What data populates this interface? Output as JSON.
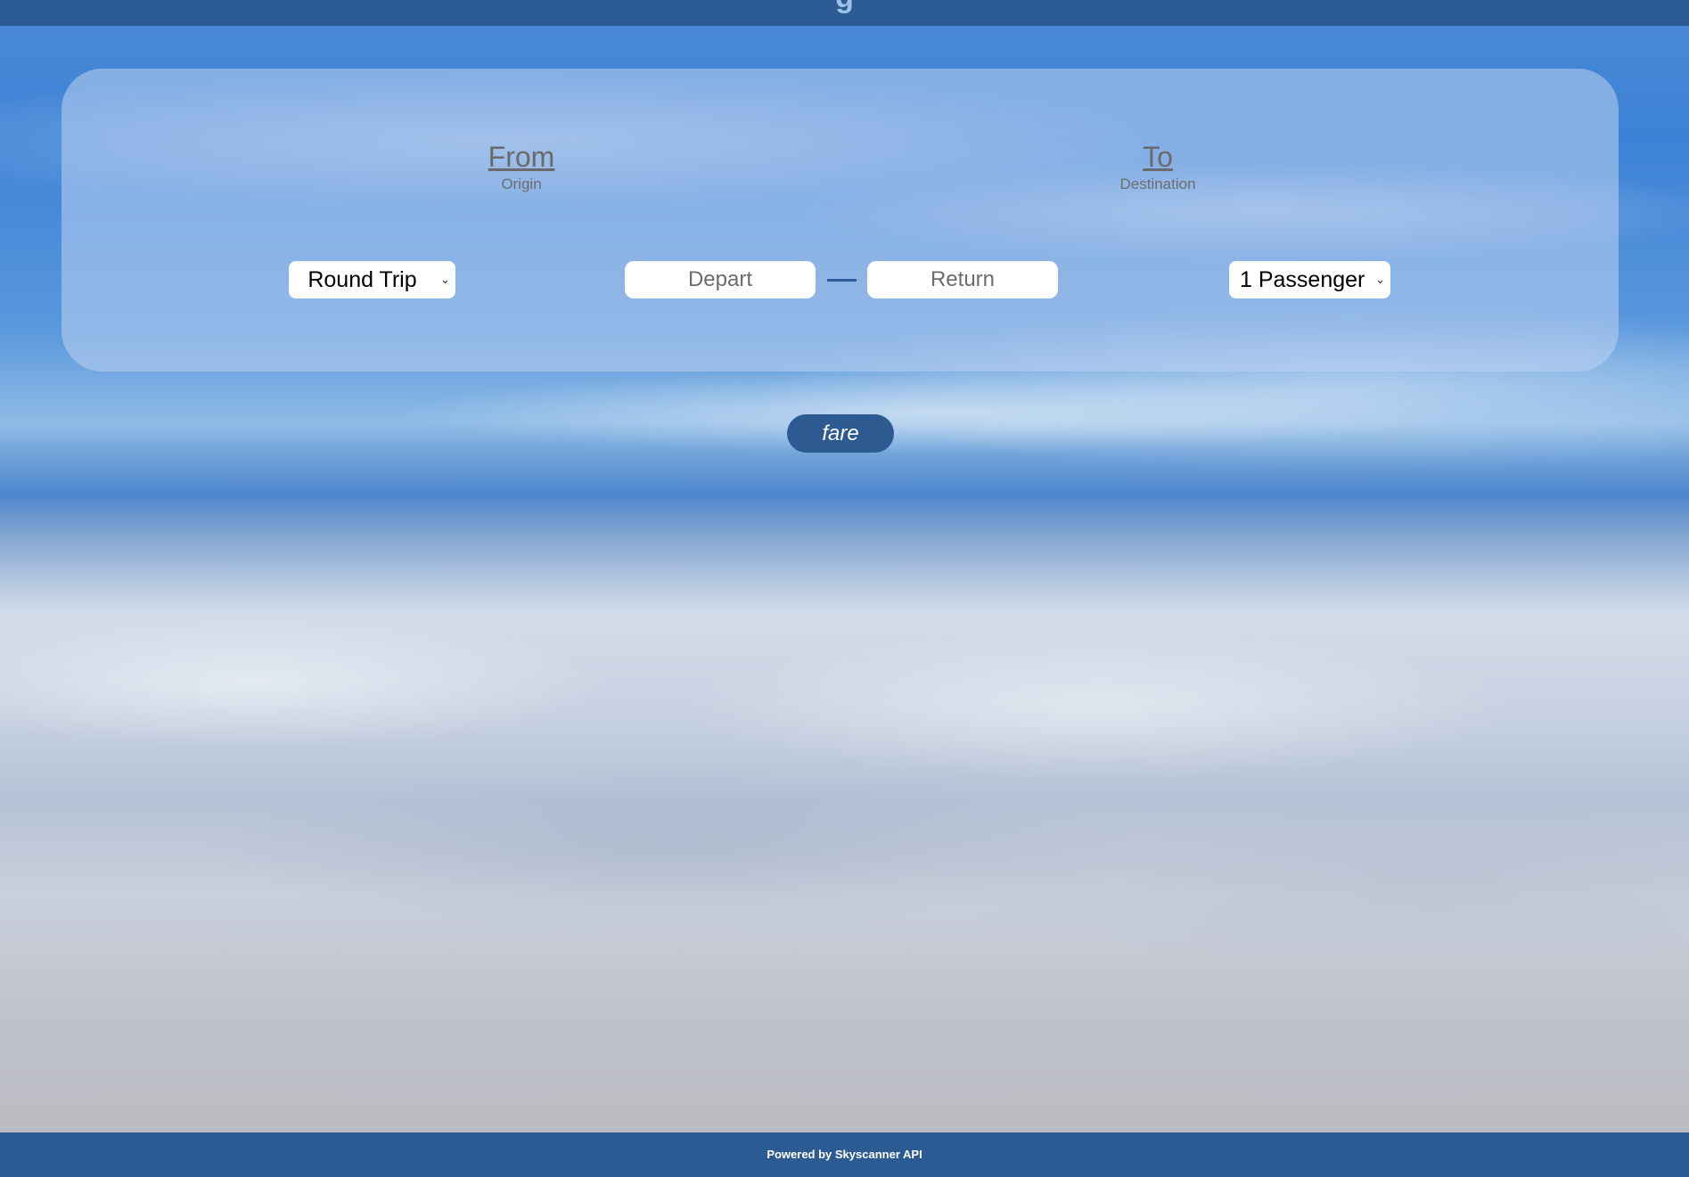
{
  "header": {
    "brand": "g"
  },
  "search": {
    "from": {
      "label": "From",
      "sublabel": "Origin"
    },
    "to": {
      "label": "To",
      "sublabel": "Destination"
    },
    "trip_type": {
      "selected": "Round Trip"
    },
    "depart": {
      "placeholder": "Depart"
    },
    "return": {
      "placeholder": "Return"
    },
    "passengers": {
      "selected": "1 Passenger"
    }
  },
  "action": {
    "fare_label": "fare"
  },
  "footer": {
    "credit": "Powered by Skyscanner API"
  },
  "colors": {
    "bar": "#2c5a93",
    "button": "#2d5a91"
  }
}
